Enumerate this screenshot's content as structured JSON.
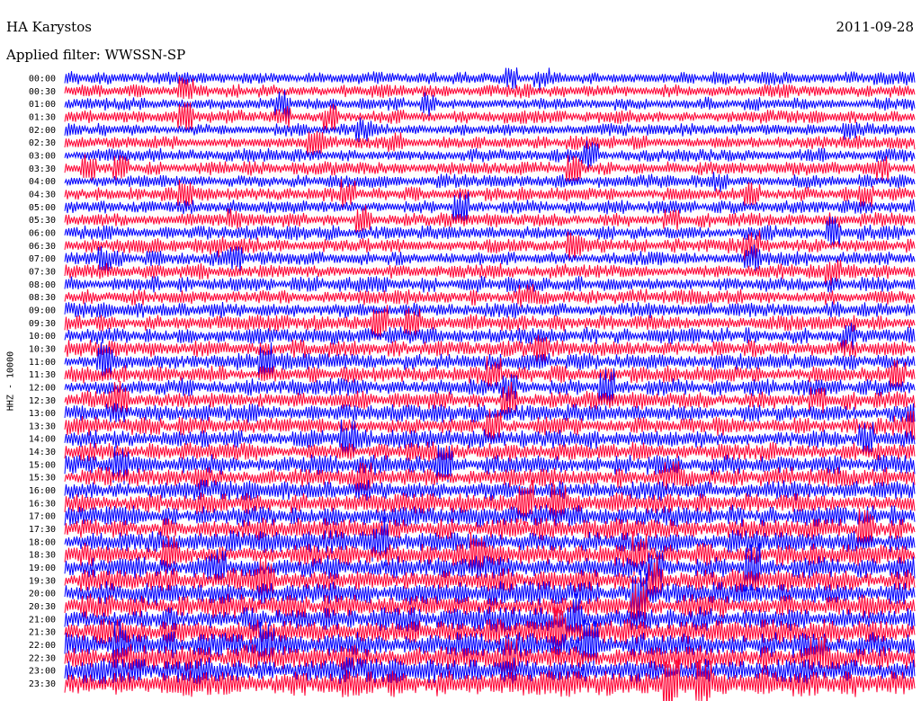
{
  "header": {
    "station": "HA Karystos",
    "date": "2011-09-28",
    "filter": "Applied filter: WWSSN-SP"
  },
  "channel_label": "HHZ - 10000",
  "colors": {
    "trace_a": "#0000ff",
    "trace_b": "#ff0033",
    "background": "#ffffff"
  },
  "chart_data": {
    "type": "line",
    "description_type": "helicorder",
    "row_labels": [
      "00:00",
      "00:30",
      "01:00",
      "01:30",
      "02:00",
      "02:30",
      "03:00",
      "03:30",
      "04:00",
      "04:30",
      "05:00",
      "05:30",
      "06:00",
      "06:30",
      "07:00",
      "07:30",
      "08:00",
      "08:30",
      "09:00",
      "09:30",
      "10:00",
      "10:30",
      "11:00",
      "11:30",
      "12:00",
      "12:30",
      "13:00",
      "13:30",
      "14:00",
      "14:30",
      "15:00",
      "15:30",
      "16:00",
      "16:30",
      "17:00",
      "17:30",
      "18:00",
      "18:30",
      "19:00",
      "19:30",
      "20:00",
      "20:30",
      "21:00",
      "21:30",
      "22:00",
      "22:30",
      "23:00",
      "23:30"
    ],
    "series_colors_alternating": [
      "#0000ff",
      "#ff0033"
    ],
    "amplitude_trend": "higher amplitude in later rows (19:30-23:30)"
  }
}
